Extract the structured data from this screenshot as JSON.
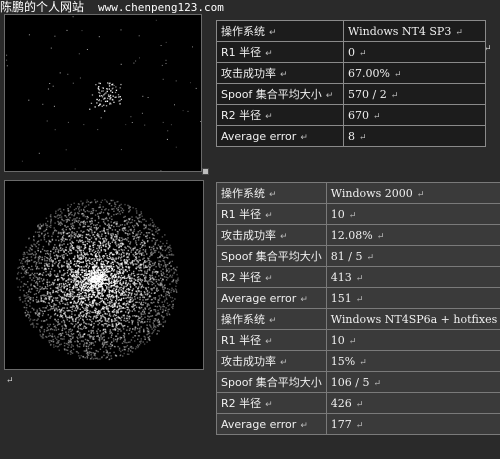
{
  "watermark": {
    "name": "陈鹏的个人网站",
    "url": "www.chenpeng123.com"
  },
  "paragraph_mark": "↵",
  "table1": [
    {
      "key": "操作系统",
      "value": "Windows NT4 SP3"
    },
    {
      "key": "R1 半径",
      "value": "0"
    },
    {
      "key": "攻击成功率",
      "value": "67.00%"
    },
    {
      "key": "Spoof 集合平均大小",
      "value": "570 / 2"
    },
    {
      "key": "R2 半径",
      "value": "670"
    },
    {
      "key": "Average error",
      "value": "8"
    }
  ],
  "table2": [
    {
      "key": "操作系统",
      "value": "Windows 2000"
    },
    {
      "key": "R1 半径",
      "value": "10"
    },
    {
      "key": "攻击成功率",
      "value": "12.08%"
    },
    {
      "key": "Spoof 集合平均大小",
      "value": "81 / 5"
    },
    {
      "key": "R2 半径",
      "value": "413"
    },
    {
      "key": "Average error",
      "value": "151"
    },
    {
      "key": "操作系统",
      "value": "Windows NT4SP6a + hotfixes"
    },
    {
      "key": "R1 半径",
      "value": "10"
    },
    {
      "key": "攻击成功率",
      "value": "15%"
    },
    {
      "key": "Spoof 集合平均大小",
      "value": "106 / 5"
    },
    {
      "key": "R2 半径",
      "value": "426"
    },
    {
      "key": "Average error",
      "value": "177"
    }
  ]
}
